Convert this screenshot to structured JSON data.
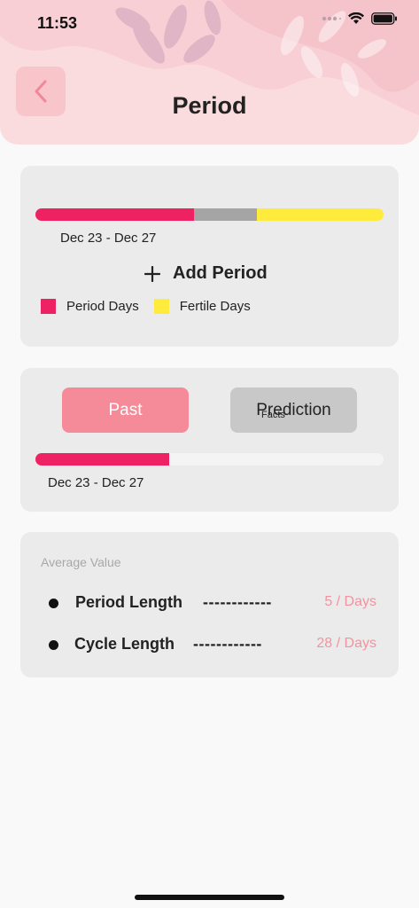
{
  "status_bar": {
    "time": "11:53"
  },
  "header": {
    "title": "Period"
  },
  "cycle_card": {
    "bar_fractions": {
      "period": 0.455,
      "gap": 0.18,
      "fertile": 0.365
    },
    "date_range": "Dec 23 - Dec 27",
    "add_label": "Add Period",
    "legend": [
      {
        "label": "Period Days",
        "color": "#ee2262"
      },
      {
        "label": "Fertile Days",
        "color": "#ffeb3b"
      }
    ]
  },
  "history_card": {
    "tabs": {
      "past": "Past",
      "prediction": "Prediction",
      "facts": "Facts"
    },
    "progress": 0.385,
    "date_range": "Dec 23 - Dec 27"
  },
  "average_card": {
    "title": "Average Value",
    "rows": [
      {
        "label": "Period Length",
        "dashes": "------------",
        "value": "5 / Days"
      },
      {
        "label": "Cycle Length",
        "dashes": "------------",
        "value": "28 / Days"
      }
    ]
  },
  "colors": {
    "period": "#ee2262",
    "gap": "#a5a5a5",
    "fertile": "#ffeb3b",
    "accent_pink": "#f58b98",
    "header_bg": "#fadcdf"
  }
}
